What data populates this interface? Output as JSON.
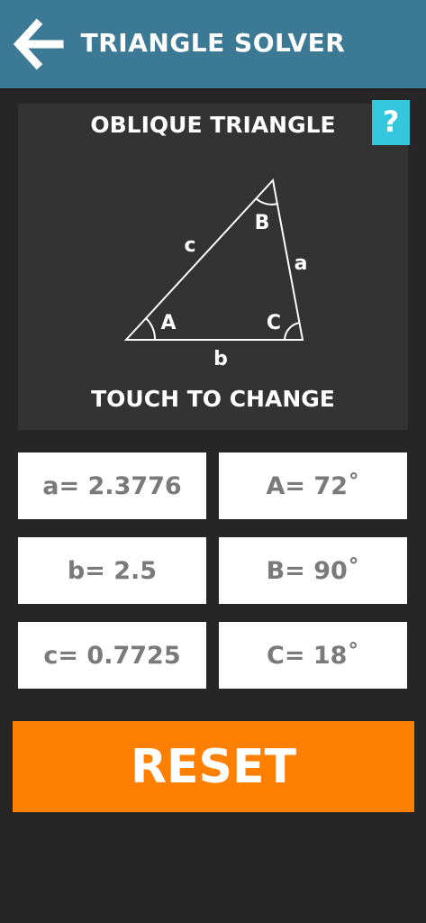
{
  "header": {
    "title": "TRIANGLE SOLVER",
    "back_icon": "arrow-left-icon"
  },
  "panel": {
    "title": "OBLIQUE TRIANGLE",
    "hint": "TOUCH TO CHANGE",
    "help_label": "?",
    "labels": {
      "side_a": "a",
      "side_b": "b",
      "side_c": "c",
      "angle_A": "A",
      "angle_B": "B",
      "angle_C": "C"
    }
  },
  "values": {
    "side_a": "a= 2.3776",
    "side_b": "b= 2.5",
    "side_c": "c= 0.7725",
    "angle_A": "A= 72˚",
    "angle_B": "B= 90˚",
    "angle_C": "C= 18˚"
  },
  "reset_label": "RESET",
  "colors": {
    "header": "#3c7994",
    "background": "#262626",
    "panel": "#333333",
    "help": "#34c6dc",
    "reset": "#ff8000",
    "value_text": "#7a7a7a"
  }
}
